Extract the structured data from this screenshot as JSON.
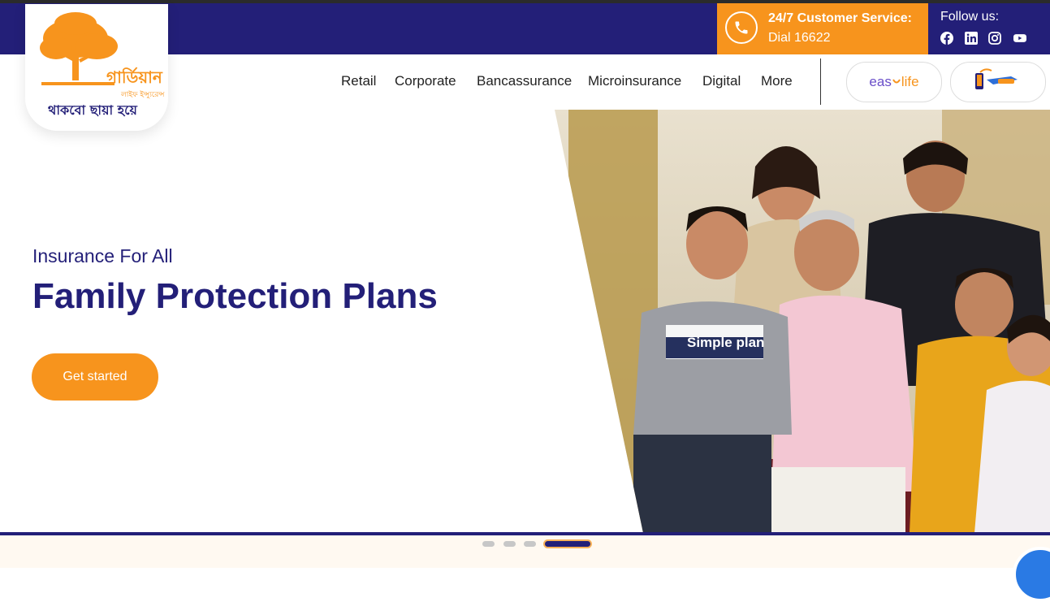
{
  "header": {
    "customer_service_title": "24/7 Customer Service:",
    "customer_service_sub": "Dial 16622",
    "follow_label": "Follow us:",
    "social_icons": [
      "facebook-icon",
      "linkedin-icon",
      "instagram-icon",
      "youtube-icon"
    ]
  },
  "logo": {
    "line1": "গার্ডিয়ান",
    "line2": "লাইফ ইন্স্যুরেন্স",
    "tagline": "থাকবো ছায়া হয়ে"
  },
  "nav": {
    "items": [
      "Retail",
      "Corporate",
      "Bancassurance",
      "Microinsurance",
      "Digital",
      "More"
    ],
    "easylife_a": "eas",
    "easylife_b": "life"
  },
  "hero": {
    "subtitle": "Insurance For All",
    "title": "Family Protection Plans",
    "cta": "Get started",
    "shirt_text": "Simple plan"
  },
  "carousel": {
    "slides": 4,
    "active": 4
  },
  "colors": {
    "brand_navy": "#231f78",
    "brand_orange": "#f7941d"
  }
}
